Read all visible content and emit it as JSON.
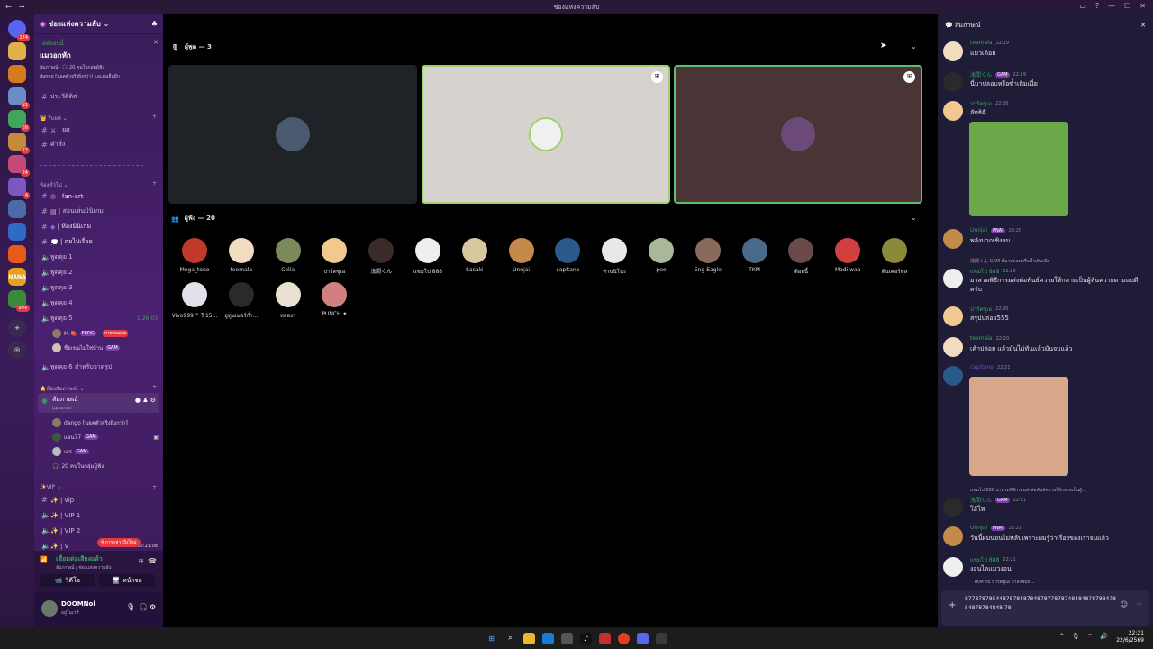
{
  "window": {
    "title": "ช่องแห่งความลับ"
  },
  "servers": [
    {
      "badge": "174",
      "color": "#5865f2",
      "icon": "discord-home-icon"
    },
    {
      "badge": "",
      "color": "#e0b04a",
      "icon": "server-icon"
    },
    {
      "badge": "",
      "color": "#d57a1f",
      "icon": "server-icon"
    },
    {
      "badge": "31",
      "color": "#6b8cc7",
      "icon": "server-icon"
    },
    {
      "badge": "69",
      "color": "#3fa65a",
      "icon": "server-icon"
    },
    {
      "badge": "72",
      "color": "#c58a3a",
      "icon": "server-icon"
    },
    {
      "badge": "24",
      "color": "#c44a7a",
      "icon": "server-icon"
    },
    {
      "badge": "4",
      "color": "#7c57c2",
      "icon": "server-icon"
    },
    {
      "badge": "",
      "color": "#4a6aa8",
      "icon": "server-icon"
    },
    {
      "badge": "",
      "color": "#2f6bc4",
      "icon": "server-icon"
    },
    {
      "badge": "",
      "color": "#e85a1c",
      "icon": "server-icon"
    },
    {
      "badge": "",
      "color": "#e8a020",
      "icon": "server-icon",
      "label": "NANA"
    },
    {
      "badge": "99+",
      "color": "#3b8a3b",
      "icon": "server-icon"
    }
  ],
  "sidebar": {
    "server_name": "ช่องแห่งความลับ",
    "event": {
      "label": "ไลฟ์ตอนนี้",
      "title": "แมวอกหัก",
      "sub1": "สัมภาษณ์ · 🎧 20 คนในกลุ่มผู้ฟัง",
      "sub2": "dango [นอคตัวจริงยิ่งกว่า] และคนอื่นอีก"
    },
    "ch_rules": "ประวัติดิส",
    "cat1": "รีบยศ",
    "ch_yot": "ยศ",
    "ch_kamsang": "คำสั่ง",
    "cat2": "ห้องทั่วไป",
    "ch_fanart": "| fan-art",
    "ch_sontham": "| สอนเล่นมินิเกม",
    "ch_minigame": "| ห้องมินิเกม",
    "ch_kuy": "| คุยไปเรื่อย",
    "voice": [
      "พูดคุย 1",
      "พูดคุย 2",
      "พูดคุย 3",
      "พูดคุย 4",
      "พูดคุย 5"
    ],
    "voice5_time": "1:26:03",
    "voice5_users": [
      {
        "name": "M.🍓",
        "tag": "FROG",
        "badge": "ถ่ายทอดสด"
      },
      {
        "name": "ชื่อเขนไม่ใช่บ้าน",
        "tag": "GAM"
      }
    ],
    "voice6": "พูดคุย 6 สำหรับวาดรูป",
    "cat3": "ห้องสัมภาษณ์",
    "stage": {
      "name": "สัมภาษณ์",
      "sub": "แมวอกหัก"
    },
    "stage_users": [
      {
        "name": "dango [นอคตัวจริงยิ่งกว่า]",
        "tag": ""
      },
      {
        "name": "แจน77",
        "tag": "GAM"
      },
      {
        "name": "เสร",
        "tag": "GAM"
      }
    ],
    "stage_listeners": "20 คนในกลุ่มผู้ฟัง",
    "cat4": "VIP",
    "vip": [
      "| vip",
      "| VIP 1",
      "| VIP 2",
      "| V"
    ],
    "vip_time": "1982:21:08",
    "new_msg": "4 การกล่าวถึงใหม่",
    "voice_connected": "เชื่อมต่อเสียงแล้ว",
    "voice_location": "สัมภาษณ์ / ช่องแห่งความลับ",
    "btn_video": "วิดีโอ",
    "btn_screen": "หน้าจอ",
    "user": {
      "name": "DOOMNol",
      "status": "อยู่ในเวที"
    }
  },
  "main": {
    "speakers_label": "ผู้พูด — 3",
    "listeners_label": "ผู้ฟัง — 20",
    "speakers": [
      {
        "bg": "#1f2328",
        "av": "#4a5a6e",
        "border": "none"
      },
      {
        "bg": "#d6d3ce",
        "av": "#f0f0f0",
        "border": "#9fd36a"
      },
      {
        "bg": "#4a3436",
        "av": "#6b4a7a",
        "border": "#57c26b"
      }
    ],
    "listeners": [
      {
        "name": "Mega_tono",
        "color": "#c0392b"
      },
      {
        "name": "teemala",
        "color": "#f2dcc0"
      },
      {
        "name": "Celia",
        "color": "#7a8a5a"
      },
      {
        "name": "ปาร์ตซูเอ",
        "color": "#f0c890"
      },
      {
        "name": "浅間くん",
        "color": "#3a2a2a"
      },
      {
        "name": "แชมโป 888",
        "color": "#eeeeee"
      },
      {
        "name": "Sasaki",
        "color": "#d8c8a0"
      },
      {
        "name": "Unnjai",
        "color": "#c48a4a"
      },
      {
        "name": "capitano",
        "color": "#2a5a8a"
      },
      {
        "name": "ท่านนิโนะ",
        "color": "#e8e8e8"
      },
      {
        "name": "pee",
        "color": "#a8b898"
      },
      {
        "name": "Eng-Eagle",
        "color": "#8a6a5a"
      },
      {
        "name": "TKM",
        "color": "#4a6a8a"
      },
      {
        "name": "ต้อยนี้",
        "color": "#6a4a4a"
      },
      {
        "name": "Madi waa",
        "color": "#d04040"
      },
      {
        "name": "ต้นเคอร์พุล",
        "color": "#8a8a3a"
      },
      {
        "name": "Vivo999™ รี 15...",
        "color": "#e0e0e8"
      },
      {
        "name": "ยูทูนเมอร์ก่ำ...",
        "color": "#2a2a2a"
      },
      {
        "name": "หลองๆ",
        "color": "#e8e0d0"
      },
      {
        "name": "PUNCH ✦",
        "color": "#d08080"
      }
    ]
  },
  "chat": {
    "title": "สัมภาษณ์",
    "messages": [
      {
        "name": "teemala",
        "color": "#3ba55c",
        "time": "22:19",
        "text": "แมวเด้อย",
        "tag": ""
      },
      {
        "name": "浅間くん",
        "color": "#3ba55c",
        "time": "22:19",
        "text": "นี่มาปลอบหรือซ้ำเติมเนี่ย",
        "tag": "GAM"
      },
      {
        "name": "ปาร์ตซูเอ",
        "color": "#3ba55c",
        "time": "22:20",
        "text": "ลัทธิดี",
        "tag": ""
      },
      {
        "name": "Unnjai",
        "color": "#3ba55c",
        "time": "22:20",
        "text": "พลังบวกเชิงลบ",
        "tag": "PNAI"
      },
      {
        "name": "แชมโป 888",
        "color": "#3ba55c",
        "time": "22:20",
        "text": "มาสวดพิธีกรรมส่งพ่อพันธ์ควายให้กลายเป็นผู้ทันควายตามแบดีครับ",
        "tag": "",
        "reply": "浅間くん GAM นี่มาปลอบหรือซ้ำเติมเนี่ย"
      },
      {
        "name": "ปาร์ตซูเอ",
        "color": "#3ba55c",
        "time": "22:20",
        "text": "สรุปปล่อย555",
        "tag": ""
      },
      {
        "name": "teemala",
        "color": "#3ba55c",
        "time": "22:20",
        "text": "เค้าปล่อย แล้วมันไม่ทันแล้วมันจบแล้ว",
        "tag": ""
      },
      {
        "name": "capitano",
        "color": "#7a4ac4",
        "time": "22:21",
        "text": "",
        "tag": ""
      },
      {
        "name": "浅間くん",
        "color": "#3ba55c",
        "time": "22:21",
        "text": "โอ้โห",
        "tag": "GAM",
        "reply": "แชมโป 888 มาสวดพิธีกรรมส่งพ่อพันธ์ควายให้กลายเป็นผู้..."
      },
      {
        "name": "Unnjai",
        "color": "#3ba55c",
        "time": "22:21",
        "text": "วันนี้ผมนอนไม่หลับเพราะผมรู้ว่าเรื่องของเราจบแล้ว",
        "tag": "PNAI"
      },
      {
        "name": "แชมโป 888",
        "color": "#3ba55c",
        "time": "22:21",
        "text": "งอนไลแมวงอน",
        "tag": ""
      }
    ],
    "typing": "TKM กับ ปาร์ตซูเอ กำลังพิมพ์...",
    "input_text": "8778787854487878487848787787874848487878847854878784848 78"
  },
  "taskbar": {
    "time": "22:21",
    "date": "22/6/2569"
  }
}
